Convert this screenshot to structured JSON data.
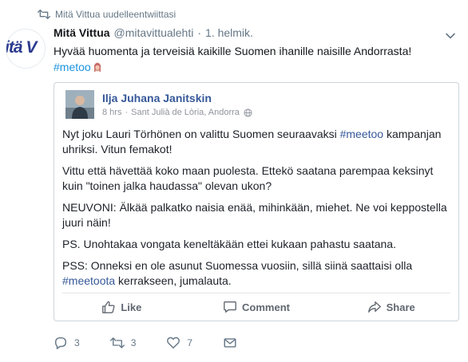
{
  "retweet_context": {
    "text": "Mitä Vittua uudelleentwiittasi"
  },
  "avatar": {
    "text_left": "itä V",
    "text_right": ""
  },
  "tweet": {
    "author_name": "Mitä Vittua",
    "handle": "@mitavittualehti",
    "separator": "·",
    "date": "1. helmik.",
    "text": "Hyvää huomenta ja terveisiä kaikille Suomen ihanille naisille Andorrasta!",
    "hashtag": "#metoo",
    "emoji": "woman-emoji"
  },
  "embedded_post": {
    "author": "Ilja Juhana Janitskin",
    "time": "8 hrs",
    "separator": "·",
    "location": "Sant Julià de Lòria, Andorra",
    "paragraph1_pre": "Nyt joku Lauri Törhönen on valittu Suomen seuraavaksi ",
    "paragraph1_tag": "#meetoo",
    "paragraph1_post": " kampanjan uhriksi. Vitun femakot!",
    "paragraph2": "Vittu että hävettää koko maan puolesta. Ettekö saatana parempaa keksinyt kuin \"toinen jalka haudassa\" olevan ukon?",
    "paragraph3": "NEUVONI: Älkää palkatko naisia enää, mihinkään, miehet. Ne voi keppostella juuri näin!",
    "paragraph4": "PS. Unohtakaa vongata keneltäkään ettei kukaan pahastu saatana.",
    "paragraph5_pre": "PSS: Onneksi en ole asunut Suomessa vuosiin, sillä siinä saattaisi olla ",
    "paragraph5_tag": "#meetoota",
    "paragraph5_post": " kerrakseen, jumalauta.",
    "actions": {
      "like": "Like",
      "comment": "Comment",
      "share": "Share"
    }
  },
  "tweet_actions": {
    "replies": "3",
    "retweets": "3",
    "likes": "7"
  },
  "colors": {
    "link_blue": "#1b95e0",
    "fb_blue": "#365899",
    "muted": "#657786",
    "border": "#ccd6dd"
  }
}
